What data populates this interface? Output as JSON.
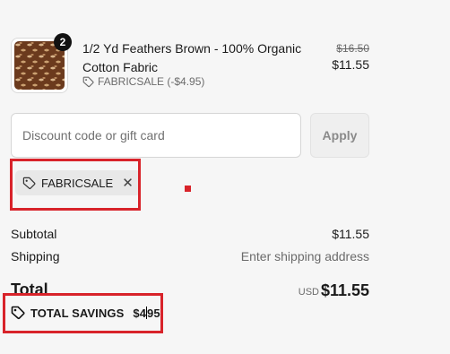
{
  "product": {
    "quantity": "2",
    "name": "1/2 Yd Feathers Brown - 100% Organic Cotton Fabric",
    "discount_tag": "FABRICSALE (-$4.95)",
    "original_price": "$16.50",
    "price": "$11.55"
  },
  "discount": {
    "placeholder": "Discount code or gift card",
    "apply_label": "Apply",
    "applied_code": "FABRICSALE",
    "remove_symbol": "✕"
  },
  "summary": {
    "subtotal_label": "Subtotal",
    "subtotal_value": "$11.55",
    "shipping_label": "Shipping",
    "shipping_value": "Enter shipping address",
    "total_label": "Total",
    "currency": "USD",
    "total_value": "$11.55",
    "savings_label": "TOTAL SAVINGS",
    "savings_prefix": "$4",
    "savings_suffix": "95"
  },
  "colors": {
    "highlight": "#d8232a",
    "background": "#f6f6f6"
  }
}
